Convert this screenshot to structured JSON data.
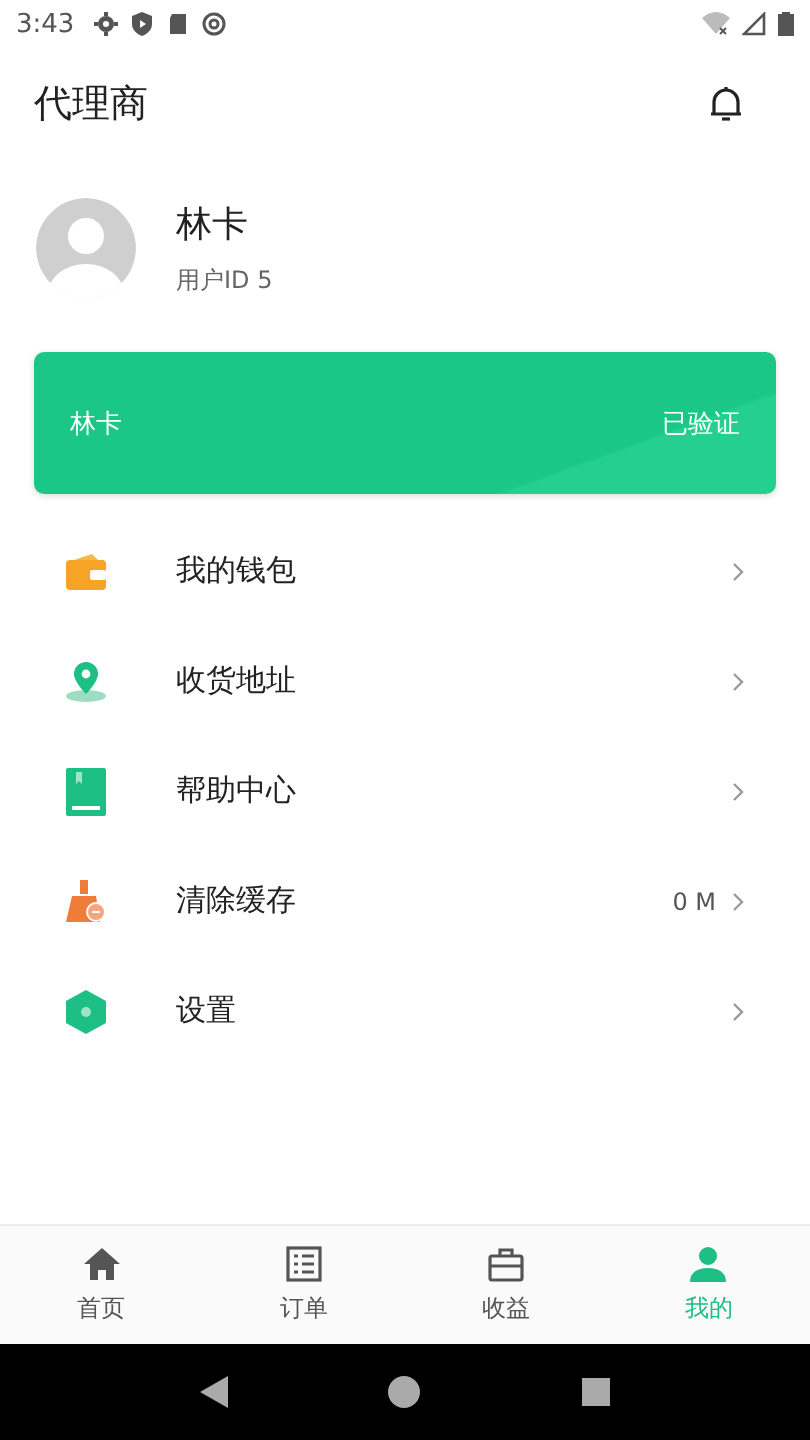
{
  "status_bar": {
    "time": "3:43"
  },
  "header": {
    "title": "代理商"
  },
  "profile": {
    "name": "林卡",
    "user_id": "用户ID 5"
  },
  "card": {
    "name": "林卡",
    "status": "已验证"
  },
  "menu": [
    {
      "kind": "wallet",
      "label": "我的钱包"
    },
    {
      "kind": "address",
      "label": "收货地址"
    },
    {
      "kind": "help",
      "label": "帮助中心"
    },
    {
      "kind": "cache",
      "label": "清除缓存",
      "value": "0 M"
    },
    {
      "kind": "settings",
      "label": "设置"
    }
  ],
  "tabs": [
    {
      "kind": "home",
      "label": "首页",
      "selected": false
    },
    {
      "kind": "orders",
      "label": "订单",
      "selected": false
    },
    {
      "kind": "earnings",
      "label": "收益",
      "selected": false
    },
    {
      "kind": "me",
      "label": "我的",
      "selected": true
    }
  ]
}
